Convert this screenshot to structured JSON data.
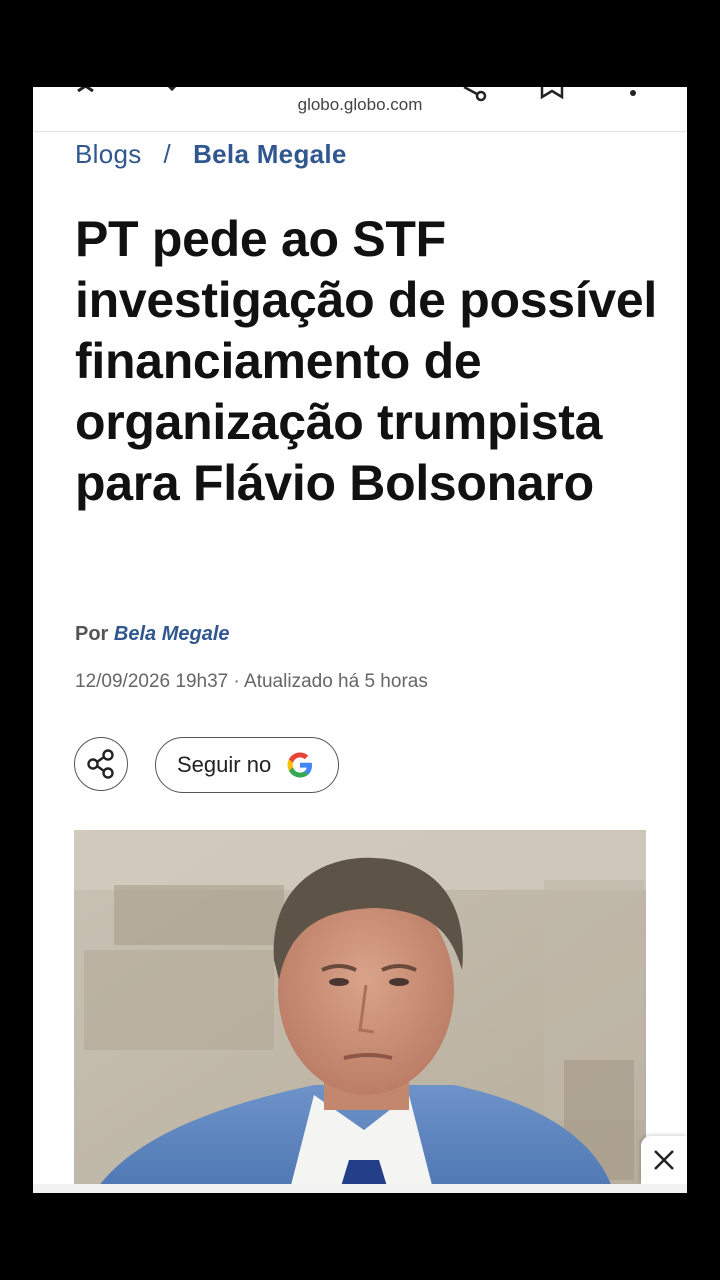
{
  "browser": {
    "url": "globo.globo.com",
    "icons": [
      "close-icon",
      "chevron-down-icon",
      "share-icon",
      "bookmark-icon",
      "more-icon"
    ]
  },
  "breadcrumb": {
    "section": "Blogs",
    "separator": "/",
    "current": "Bela Megale"
  },
  "article": {
    "headline": "PT pede ao STF investigação de possível financiamento de organização trumpista para Flávio Bolsonaro",
    "byline_prefix": "Por",
    "author": "Bela Megale",
    "timestamp": "12/09/2026 19h37 · Atualizado há 5 horas"
  },
  "actions": {
    "share_icon": "share-icon",
    "follow_label": "Seguir no",
    "follow_icon": "google-g-icon"
  },
  "photo": {
    "description_icon": "article-photo"
  },
  "colors": {
    "accent": "#31578f",
    "headline": "#111111"
  }
}
